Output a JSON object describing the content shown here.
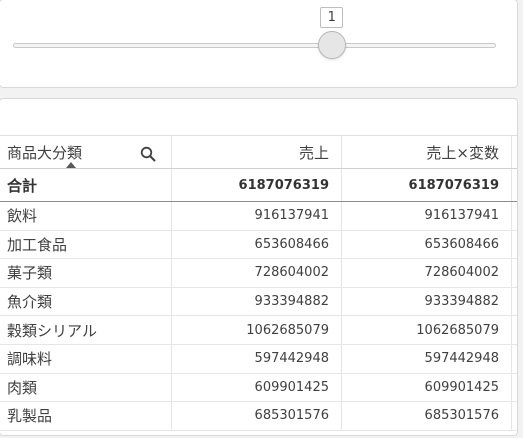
{
  "slider": {
    "value": "1",
    "level": 0.66
  },
  "table": {
    "headers": {
      "dimension": "商品大分類",
      "measure1": "売上",
      "measure2": "売上×変数"
    },
    "total": {
      "label": "合計",
      "v1": "6187076319",
      "v2": "6187076319"
    },
    "rows": [
      {
        "label": "飲料",
        "v1": "916137941",
        "v2": "916137941"
      },
      {
        "label": "加工食品",
        "v1": "653608466",
        "v2": "653608466"
      },
      {
        "label": "菓子類",
        "v1": "728604002",
        "v2": "728604002"
      },
      {
        "label": "魚介類",
        "v1": "933394882",
        "v2": "933394882"
      },
      {
        "label": "穀類シリアル",
        "v1": "1062685079",
        "v2": "1062685079"
      },
      {
        "label": "調味料",
        "v1": "597442948",
        "v2": "597442948"
      },
      {
        "label": "肉類",
        "v1": "609901425",
        "v2": "609901425"
      },
      {
        "label": "乳製品",
        "v1": "685301576",
        "v2": "685301576"
      }
    ],
    "icons": {
      "search": "search-icon",
      "sort": "sort-ascending-icon"
    }
  }
}
